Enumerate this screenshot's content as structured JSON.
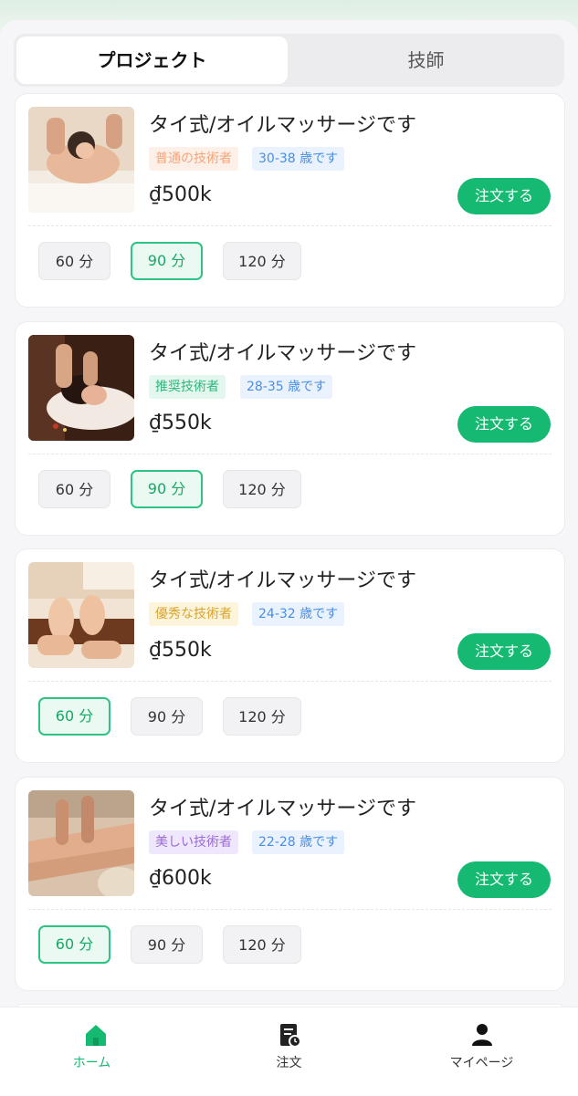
{
  "tabs": [
    {
      "label": "プロジェクト",
      "active": true
    },
    {
      "label": "技師",
      "active": false
    }
  ],
  "cards": [
    {
      "title": "タイ式/オイルマッサージです",
      "tag_level": "普通の技術者",
      "tag_age": "30-38 歳です",
      "price": "₫500k",
      "order_label": "注文する",
      "durations": [
        "60 分",
        "90 分",
        "120 分"
      ],
      "selected": 1
    },
    {
      "title": "タイ式/オイルマッサージです",
      "tag_level": "推奨技術者",
      "tag_age": "28-35 歳です",
      "price": "₫550k",
      "order_label": "注文する",
      "durations": [
        "60 分",
        "90 分",
        "120 分"
      ],
      "selected": 1
    },
    {
      "title": "タイ式/オイルマッサージです",
      "tag_level": "優秀な技術者",
      "tag_age": "24-32 歳です",
      "price": "₫550k",
      "order_label": "注文する",
      "durations": [
        "60 分",
        "90 分",
        "120 分"
      ],
      "selected": 0
    },
    {
      "title": "タイ式/オイルマッサージです",
      "tag_level": "美しい技術者",
      "tag_age": "22-28 歳です",
      "price": "₫600k",
      "order_label": "注文する",
      "durations": [
        "60 分",
        "90 分",
        "120 分"
      ],
      "selected": 0
    }
  ],
  "colors": {
    "accent": "#16b972",
    "tag_levels": [
      "#f6a57a",
      "#2fb67c",
      "#d9a42c",
      "#9b6cd6"
    ],
    "tag_level_bgs": [
      "#fdf0e8",
      "#e4f7ee",
      "#fdf4dc",
      "#efe7fb"
    ],
    "tag_age": "#4a8ee6",
    "tag_age_bg": "#eaf2fd"
  },
  "nav": [
    {
      "label": "ホーム",
      "icon": "home-icon",
      "active": true
    },
    {
      "label": "注文",
      "icon": "order-list-icon",
      "active": false
    },
    {
      "label": "マイページ",
      "icon": "user-icon",
      "active": false
    }
  ]
}
